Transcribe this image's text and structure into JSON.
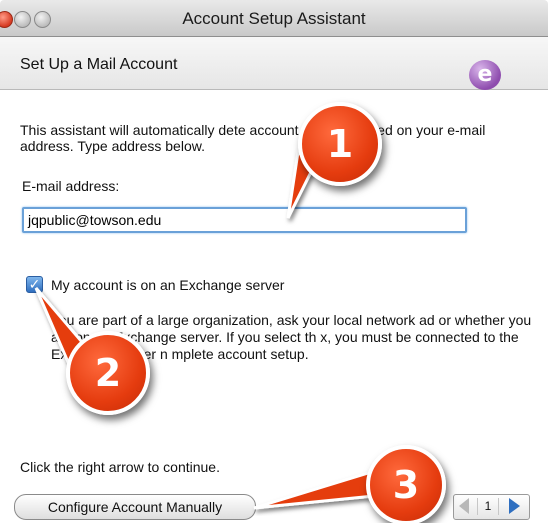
{
  "window": {
    "title": "Account Setup Assistant"
  },
  "header": {
    "title": "Set Up a Mail Account",
    "logo_glyph": "e"
  },
  "body": {
    "description": "This assistant will automatically dete account settings based on your e-mail address. Type address below.",
    "email_label": "E-mail address:",
    "email_value": "jqpublic@towson.edu",
    "exchange_checkbox_label": "My account is on an Exchange server",
    "exchange_checked": true,
    "exchange_explanation": "I  ou are part of a large organization, ask your local network ad   or whether you are on an Exchange server. If you select th  x, you must be connected to the Exchange server n  mplete account setup.",
    "hint": "Click the right arrow to continue."
  },
  "footer": {
    "manual_button_label": "Configure Account Manually",
    "page_number": "1"
  },
  "callouts": [
    {
      "label": "1"
    },
    {
      "label": "2"
    },
    {
      "label": "3"
    }
  ],
  "colors": {
    "callout_fill": "#e53c0f",
    "focus_ring": "#6aa1d8",
    "checkbox_fill": "#2f6fc0"
  }
}
